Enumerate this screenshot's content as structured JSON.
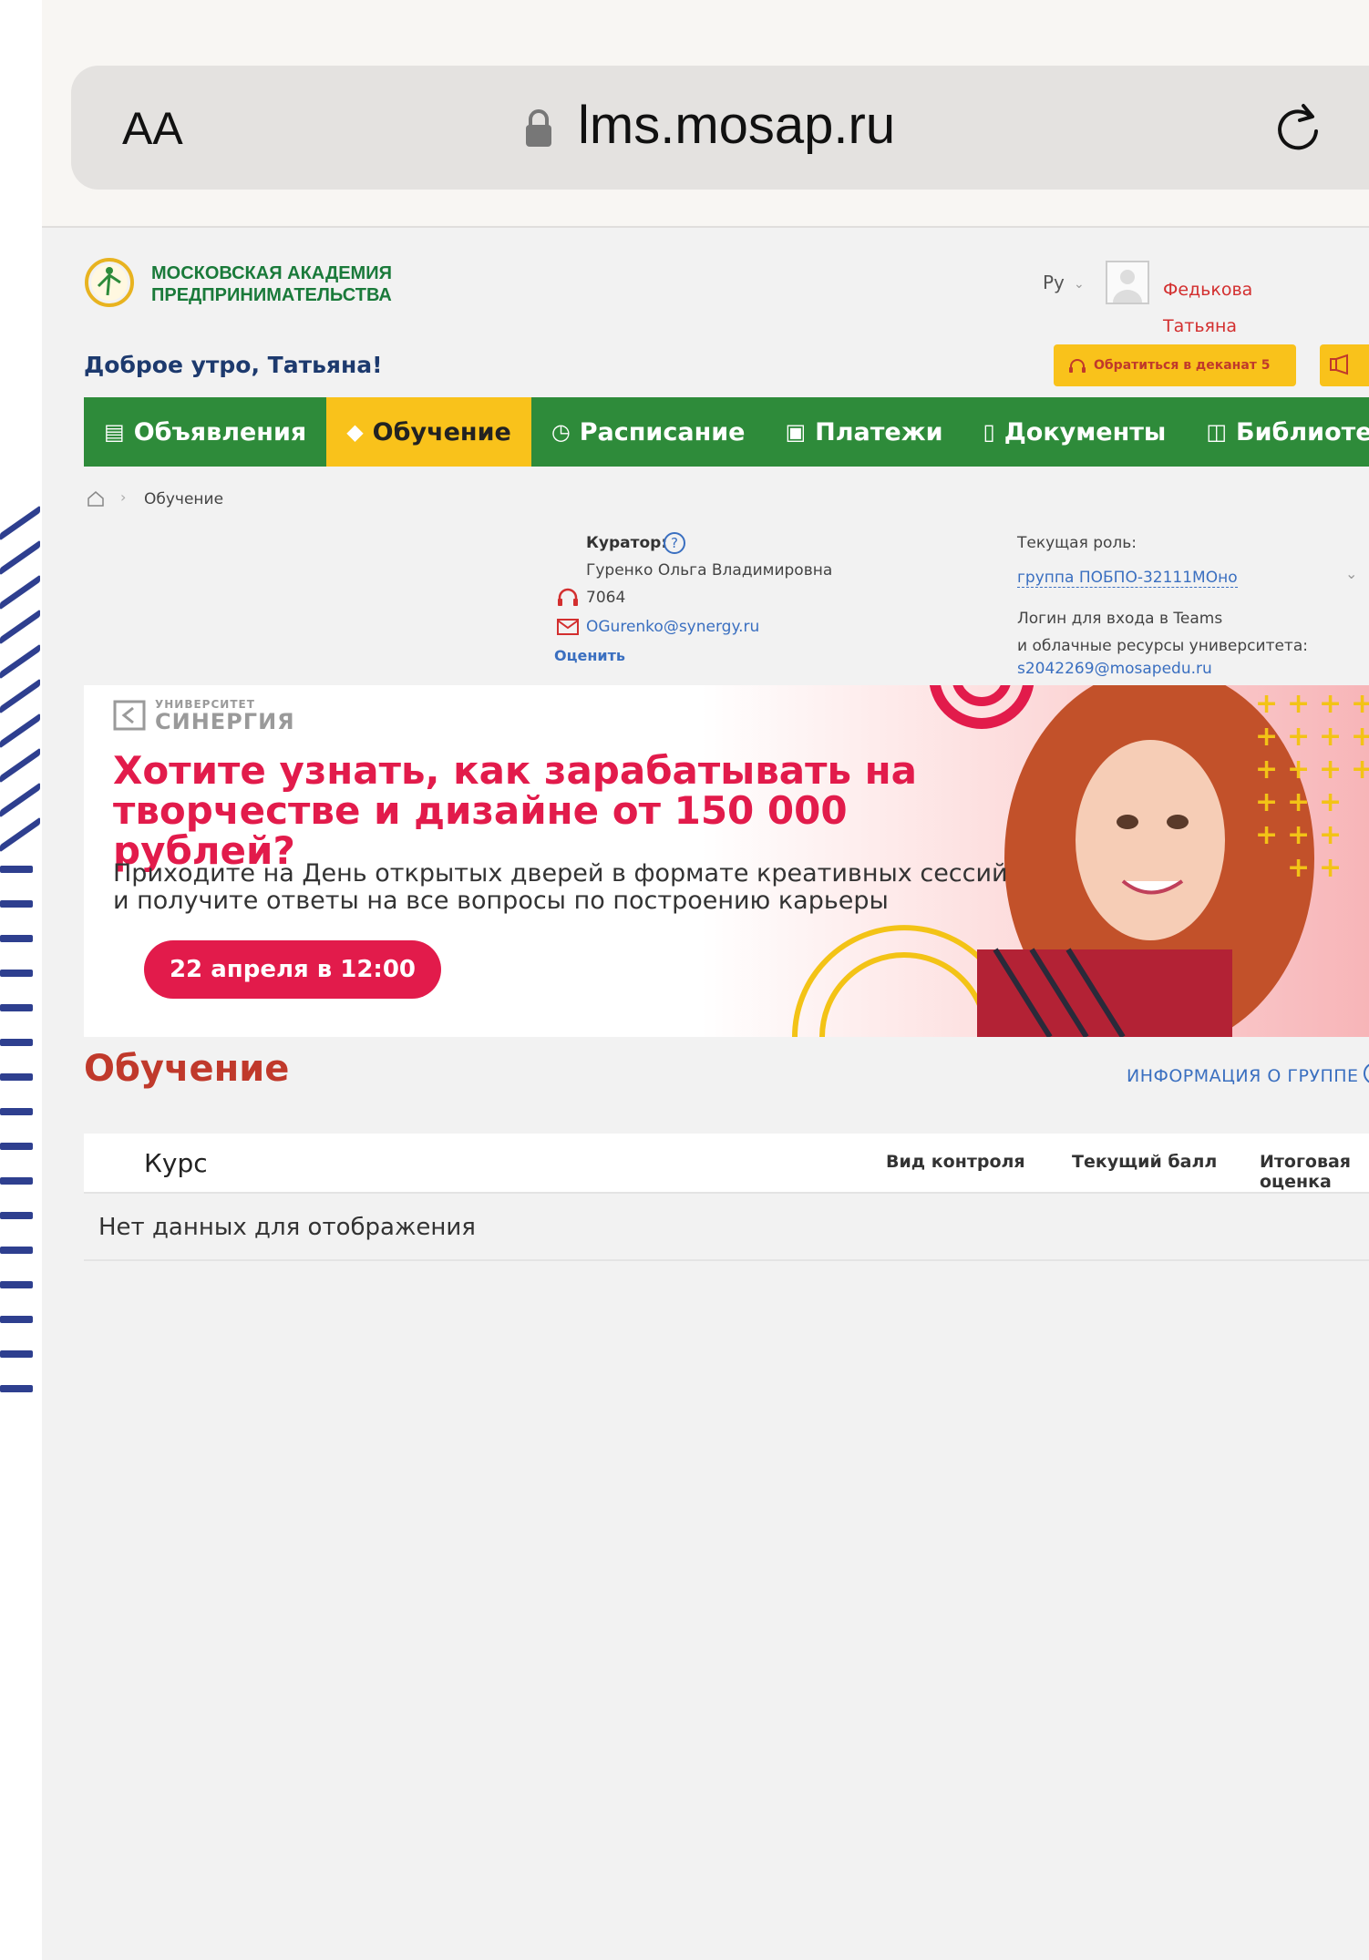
{
  "browser": {
    "text_size_label": "AA",
    "url": "lms.mosap.ru"
  },
  "header": {
    "brand_line1": "МОСКОВСКАЯ АКАДЕМИЯ",
    "brand_line2": "ПРЕДПРИНИМАТЕЛЬСТВА",
    "language": "Ру",
    "user_name": "Федькова Татьяна Сергеевна",
    "greeting": "Доброе утро, Татьяна!",
    "dean_button": "Обратиться в деканат 5"
  },
  "nav": {
    "items": [
      {
        "label": "Объявления",
        "icon": "clipboard-icon"
      },
      {
        "label": "Обучение",
        "icon": "graduation-cap-icon",
        "active": true
      },
      {
        "label": "Расписание",
        "icon": "clock-icon"
      },
      {
        "label": "Платежи",
        "icon": "wallet-icon"
      },
      {
        "label": "Документы",
        "icon": "document-icon"
      },
      {
        "label": "Библиотека",
        "icon": "book-icon"
      }
    ]
  },
  "breadcrumb": {
    "current": "Обучение"
  },
  "curator": {
    "label": "Куратор:",
    "name": "Гуренко Ольга Владимировна",
    "phone": "7064",
    "email": "OGurenko@synergy.ru",
    "rate": "Оценить"
  },
  "role": {
    "label": "Текущая роль:",
    "value": "группа ПОБПО-32111МОно",
    "teams_line1": "Логин для входа в Teams",
    "teams_line2": "и облачные ресурсы университета:",
    "teams_email": "s2042269@mosapedu.ru"
  },
  "banner": {
    "logo_small": "УНИВЕРСИТЕТ",
    "logo_big": "СИНЕРГИЯ",
    "title": "Хотите узнать, как зарабатывать на творчестве и дизайне от 150 000 рублей?",
    "subtitle": "Приходите на День открытых дверей в формате креативных сессий и получите ответы на все вопросы по построению карьеры",
    "button": "22 апреля в 12:00"
  },
  "training": {
    "title": "Обучение",
    "group_info": "ИНФОРМАЦИЯ О ГРУППЕ",
    "columns": [
      "Курс",
      "Вид контроля",
      "Текущий балл",
      "Итоговая оценка"
    ],
    "empty": "Нет данных для отображения"
  },
  "colors": {
    "nav_green": "#2e8b3a",
    "accent_yellow": "#f9c21b",
    "title_red": "#c0392b",
    "banner_red": "#e21b4b",
    "link_blue": "#3a6fc0"
  }
}
